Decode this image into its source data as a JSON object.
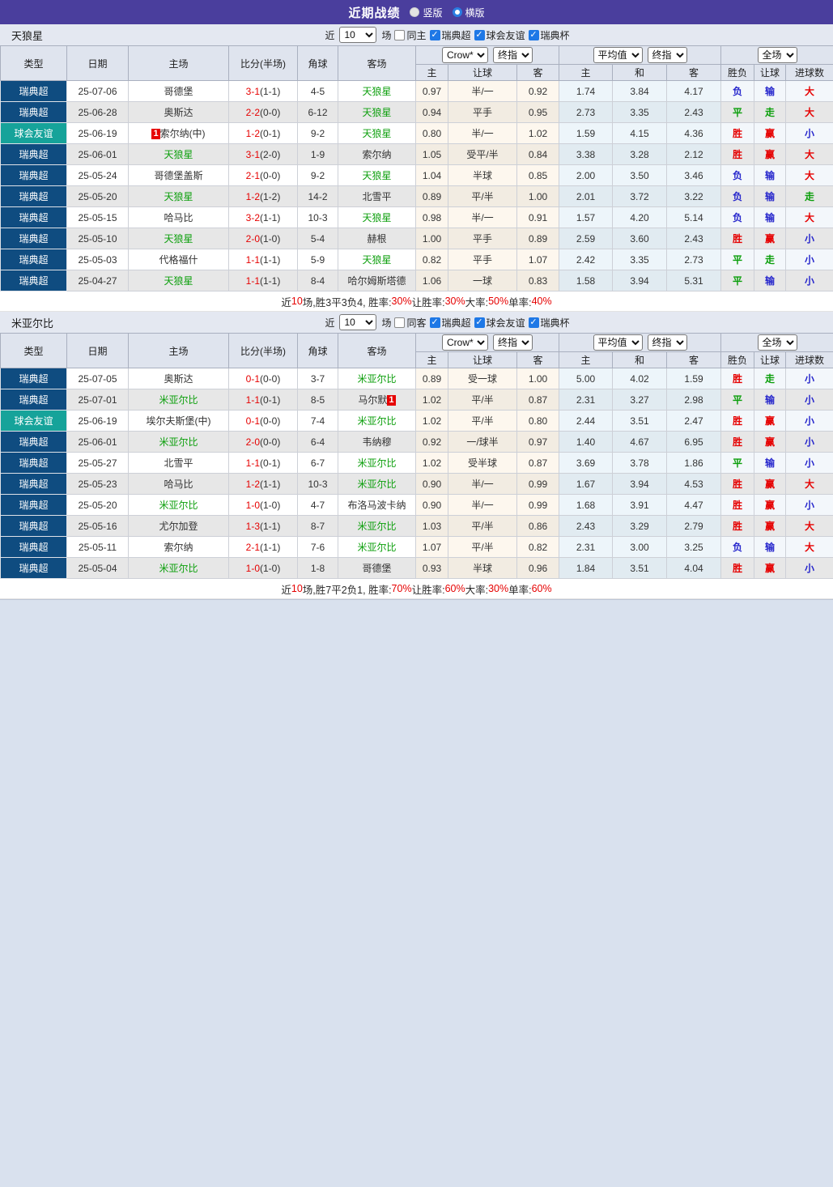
{
  "titlebar": {
    "title": "近期战绩",
    "radio_vertical": "竖版",
    "radio_horizontal": "横版",
    "selected": "横版"
  },
  "filters": {
    "near_label": "近",
    "count_value": "10",
    "unit_label": "场",
    "leagues": [
      {
        "label": "瑞典超",
        "checked": true
      },
      {
        "label": "球会友谊",
        "checked": true
      },
      {
        "label": "瑞典杯",
        "checked": true
      }
    ]
  },
  "table_header": {
    "static_cols": [
      "类型",
      "日期",
      "主场",
      "比分(半场)",
      "角球",
      "客场"
    ],
    "group1_selects": [
      "Crow*",
      "终指"
    ],
    "group2_selects": [
      "平均值",
      "终指"
    ],
    "group3_selects": [
      "全场"
    ],
    "sub_cols": [
      "主",
      "让球",
      "客",
      "主",
      "和",
      "客",
      "胜负",
      "让球",
      "进球数"
    ]
  },
  "colors": {
    "titlebar_bg": "#4a3e9d",
    "type_colors": {
      "瑞典超": "#0f4c80",
      "球会友谊": "#16a39a"
    },
    "highlight_green": "#0c9f0c",
    "score_red": "#e60000",
    "result_colors": {
      "胜": "#e60000",
      "赢": "#e60000",
      "大": "#e60000",
      "平": "#0a9e0a",
      "走": "#0a9e0a",
      "负": "#2626cc",
      "输": "#2626cc",
      "小": "#2626cc"
    }
  },
  "sections": [
    {
      "team": "天狼星",
      "same_label": "同主",
      "same_checked": false,
      "rows": [
        {
          "type": "瑞典超",
          "date": "25-07-06",
          "home": "哥德堡",
          "home_hl": false,
          "score": "3-1",
          "half": "(1-1)",
          "corner": "4-5",
          "away": "天狼星",
          "away_hl": true,
          "o1": "0.97",
          "hcap": "半/一",
          "o2": "0.92",
          "a1": "1.74",
          "a2": "3.84",
          "a3": "4.17",
          "r1": "负",
          "r2": "输",
          "r3": "大"
        },
        {
          "type": "瑞典超",
          "date": "25-06-28",
          "home": "奥斯达",
          "home_hl": false,
          "score": "2-2",
          "half": "(0-0)",
          "corner": "6-12",
          "away": "天狼星",
          "away_hl": true,
          "o1": "0.94",
          "hcap": "平手",
          "o2": "0.95",
          "a1": "2.73",
          "a2": "3.35",
          "a3": "2.43",
          "r1": "平",
          "r2": "走",
          "r3": "大"
        },
        {
          "type": "球会友谊",
          "date": "25-06-19",
          "home": "索尔纳(中)",
          "home_hl": false,
          "home_badge": "1",
          "home_badge_pos": "before",
          "score": "1-2",
          "half": "(0-1)",
          "corner": "9-2",
          "away": "天狼星",
          "away_hl": true,
          "o1": "0.80",
          "hcap": "半/一",
          "o2": "1.02",
          "a1": "1.59",
          "a2": "4.15",
          "a3": "4.36",
          "r1": "胜",
          "r2": "赢",
          "r3": "小"
        },
        {
          "type": "瑞典超",
          "date": "25-06-01",
          "home": "天狼星",
          "home_hl": true,
          "score": "3-1",
          "half": "(2-0)",
          "corner": "1-9",
          "away": "索尔纳",
          "away_hl": false,
          "o1": "1.05",
          "hcap": "受平/半",
          "o2": "0.84",
          "a1": "3.38",
          "a2": "3.28",
          "a3": "2.12",
          "r1": "胜",
          "r2": "赢",
          "r3": "大"
        },
        {
          "type": "瑞典超",
          "date": "25-05-24",
          "home": "哥德堡盖斯",
          "home_hl": false,
          "score": "2-1",
          "half": "(0-0)",
          "corner": "9-2",
          "away": "天狼星",
          "away_hl": true,
          "o1": "1.04",
          "hcap": "半球",
          "o2": "0.85",
          "a1": "2.00",
          "a2": "3.50",
          "a3": "3.46",
          "r1": "负",
          "r2": "输",
          "r3": "大"
        },
        {
          "type": "瑞典超",
          "date": "25-05-20",
          "home": "天狼星",
          "home_hl": true,
          "score": "1-2",
          "half": "(1-2)",
          "corner": "14-2",
          "away": "北雪平",
          "away_hl": false,
          "o1": "0.89",
          "hcap": "平/半",
          "o2": "1.00",
          "a1": "2.01",
          "a2": "3.72",
          "a3": "3.22",
          "r1": "负",
          "r2": "输",
          "r3": "走"
        },
        {
          "type": "瑞典超",
          "date": "25-05-15",
          "home": "哈马比",
          "home_hl": false,
          "score": "3-2",
          "half": "(1-1)",
          "corner": "10-3",
          "away": "天狼星",
          "away_hl": true,
          "o1": "0.98",
          "hcap": "半/一",
          "o2": "0.91",
          "a1": "1.57",
          "a2": "4.20",
          "a3": "5.14",
          "r1": "负",
          "r2": "输",
          "r3": "大"
        },
        {
          "type": "瑞典超",
          "date": "25-05-10",
          "home": "天狼星",
          "home_hl": true,
          "score": "2-0",
          "half": "(1-0)",
          "corner": "5-4",
          "away": "赫根",
          "away_hl": false,
          "o1": "1.00",
          "hcap": "平手",
          "o2": "0.89",
          "a1": "2.59",
          "a2": "3.60",
          "a3": "2.43",
          "r1": "胜",
          "r2": "赢",
          "r3": "小"
        },
        {
          "type": "瑞典超",
          "date": "25-05-03",
          "home": "代格福什",
          "home_hl": false,
          "score": "1-1",
          "half": "(1-1)",
          "corner": "5-9",
          "away": "天狼星",
          "away_hl": true,
          "o1": "0.82",
          "hcap": "平手",
          "o2": "1.07",
          "a1": "2.42",
          "a2": "3.35",
          "a3": "2.73",
          "r1": "平",
          "r2": "走",
          "r3": "小"
        },
        {
          "type": "瑞典超",
          "date": "25-04-27",
          "home": "天狼星",
          "home_hl": true,
          "score": "1-1",
          "half": "(1-1)",
          "corner": "8-4",
          "away": "哈尔姆斯塔德",
          "away_hl": false,
          "o1": "1.06",
          "hcap": "一球",
          "o2": "0.83",
          "a1": "1.58",
          "a2": "3.94",
          "a3": "5.31",
          "r1": "平",
          "r2": "输",
          "r3": "小"
        }
      ],
      "summary": [
        [
          "近",
          0
        ],
        [
          "10",
          1
        ],
        [
          "场,胜3平3负4, 胜率:",
          0
        ],
        [
          "30%",
          1
        ],
        [
          " 让胜率:",
          0
        ],
        [
          "30%",
          1
        ],
        [
          " 大率:",
          0
        ],
        [
          "50%",
          1
        ],
        [
          " 单率:",
          0
        ],
        [
          "40%",
          1
        ]
      ]
    },
    {
      "team": "米亚尔比",
      "same_label": "同客",
      "same_checked": false,
      "rows": [
        {
          "type": "瑞典超",
          "date": "25-07-05",
          "home": "奥斯达",
          "home_hl": false,
          "score": "0-1",
          "half": "(0-0)",
          "corner": "3-7",
          "away": "米亚尔比",
          "away_hl": true,
          "o1": "0.89",
          "hcap": "受一球",
          "o2": "1.00",
          "a1": "5.00",
          "a2": "4.02",
          "a3": "1.59",
          "r1": "胜",
          "r2": "走",
          "r3": "小"
        },
        {
          "type": "瑞典超",
          "date": "25-07-01",
          "home": "米亚尔比",
          "home_hl": true,
          "score": "1-1",
          "half": "(0-1)",
          "corner": "8-5",
          "away": "马尔默",
          "away_hl": false,
          "away_badge": "1",
          "away_badge_pos": "after",
          "o1": "1.02",
          "hcap": "平/半",
          "o2": "0.87",
          "a1": "2.31",
          "a2": "3.27",
          "a3": "2.98",
          "r1": "平",
          "r2": "输",
          "r3": "小"
        },
        {
          "type": "球会友谊",
          "date": "25-06-19",
          "home": "埃尔夫斯堡(中)",
          "home_hl": false,
          "score": "0-1",
          "half": "(0-0)",
          "corner": "7-4",
          "away": "米亚尔比",
          "away_hl": true,
          "o1": "1.02",
          "hcap": "平/半",
          "o2": "0.80",
          "a1": "2.44",
          "a2": "3.51",
          "a3": "2.47",
          "r1": "胜",
          "r2": "赢",
          "r3": "小"
        },
        {
          "type": "瑞典超",
          "date": "25-06-01",
          "home": "米亚尔比",
          "home_hl": true,
          "score": "2-0",
          "half": "(0-0)",
          "corner": "6-4",
          "away": "韦纳穆",
          "away_hl": false,
          "o1": "0.92",
          "hcap": "一/球半",
          "o2": "0.97",
          "a1": "1.40",
          "a2": "4.67",
          "a3": "6.95",
          "r1": "胜",
          "r2": "赢",
          "r3": "小"
        },
        {
          "type": "瑞典超",
          "date": "25-05-27",
          "home": "北雪平",
          "home_hl": false,
          "score": "1-1",
          "half": "(0-1)",
          "corner": "6-7",
          "away": "米亚尔比",
          "away_hl": true,
          "o1": "1.02",
          "hcap": "受半球",
          "o2": "0.87",
          "a1": "3.69",
          "a2": "3.78",
          "a3": "1.86",
          "r1": "平",
          "r2": "输",
          "r3": "小"
        },
        {
          "type": "瑞典超",
          "date": "25-05-23",
          "home": "哈马比",
          "home_hl": false,
          "score": "1-2",
          "half": "(1-1)",
          "corner": "10-3",
          "away": "米亚尔比",
          "away_hl": true,
          "o1": "0.90",
          "hcap": "半/一",
          "o2": "0.99",
          "a1": "1.67",
          "a2": "3.94",
          "a3": "4.53",
          "r1": "胜",
          "r2": "赢",
          "r3": "大"
        },
        {
          "type": "瑞典超",
          "date": "25-05-20",
          "home": "米亚尔比",
          "home_hl": true,
          "score": "1-0",
          "half": "(1-0)",
          "corner": "4-7",
          "away": "布洛马波卡纳",
          "away_hl": false,
          "o1": "0.90",
          "hcap": "半/一",
          "o2": "0.99",
          "a1": "1.68",
          "a2": "3.91",
          "a3": "4.47",
          "r1": "胜",
          "r2": "赢",
          "r3": "小"
        },
        {
          "type": "瑞典超",
          "date": "25-05-16",
          "home": "尤尔加登",
          "home_hl": false,
          "score": "1-3",
          "half": "(1-1)",
          "corner": "8-7",
          "away": "米亚尔比",
          "away_hl": true,
          "o1": "1.03",
          "hcap": "平/半",
          "o2": "0.86",
          "a1": "2.43",
          "a2": "3.29",
          "a3": "2.79",
          "r1": "胜",
          "r2": "赢",
          "r3": "大"
        },
        {
          "type": "瑞典超",
          "date": "25-05-11",
          "home": "索尔纳",
          "home_hl": false,
          "score": "2-1",
          "half": "(1-1)",
          "corner": "7-6",
          "away": "米亚尔比",
          "away_hl": true,
          "o1": "1.07",
          "hcap": "平/半",
          "o2": "0.82",
          "a1": "2.31",
          "a2": "3.00",
          "a3": "3.25",
          "r1": "负",
          "r2": "输",
          "r3": "大"
        },
        {
          "type": "瑞典超",
          "date": "25-05-04",
          "home": "米亚尔比",
          "home_hl": true,
          "score": "1-0",
          "half": "(1-0)",
          "corner": "1-8",
          "away": "哥德堡",
          "away_hl": false,
          "o1": "0.93",
          "hcap": "半球",
          "o2": "0.96",
          "a1": "1.84",
          "a2": "3.51",
          "a3": "4.04",
          "r1": "胜",
          "r2": "赢",
          "r3": "小"
        }
      ],
      "summary": [
        [
          "近",
          0
        ],
        [
          "10",
          1
        ],
        [
          "场,胜7平2负1, 胜率:",
          0
        ],
        [
          "70%",
          1
        ],
        [
          " 让胜率:",
          0
        ],
        [
          "60%",
          1
        ],
        [
          " 大率:",
          0
        ],
        [
          "30%",
          1
        ],
        [
          " 单率:",
          0
        ],
        [
          "60%",
          1
        ]
      ]
    }
  ]
}
